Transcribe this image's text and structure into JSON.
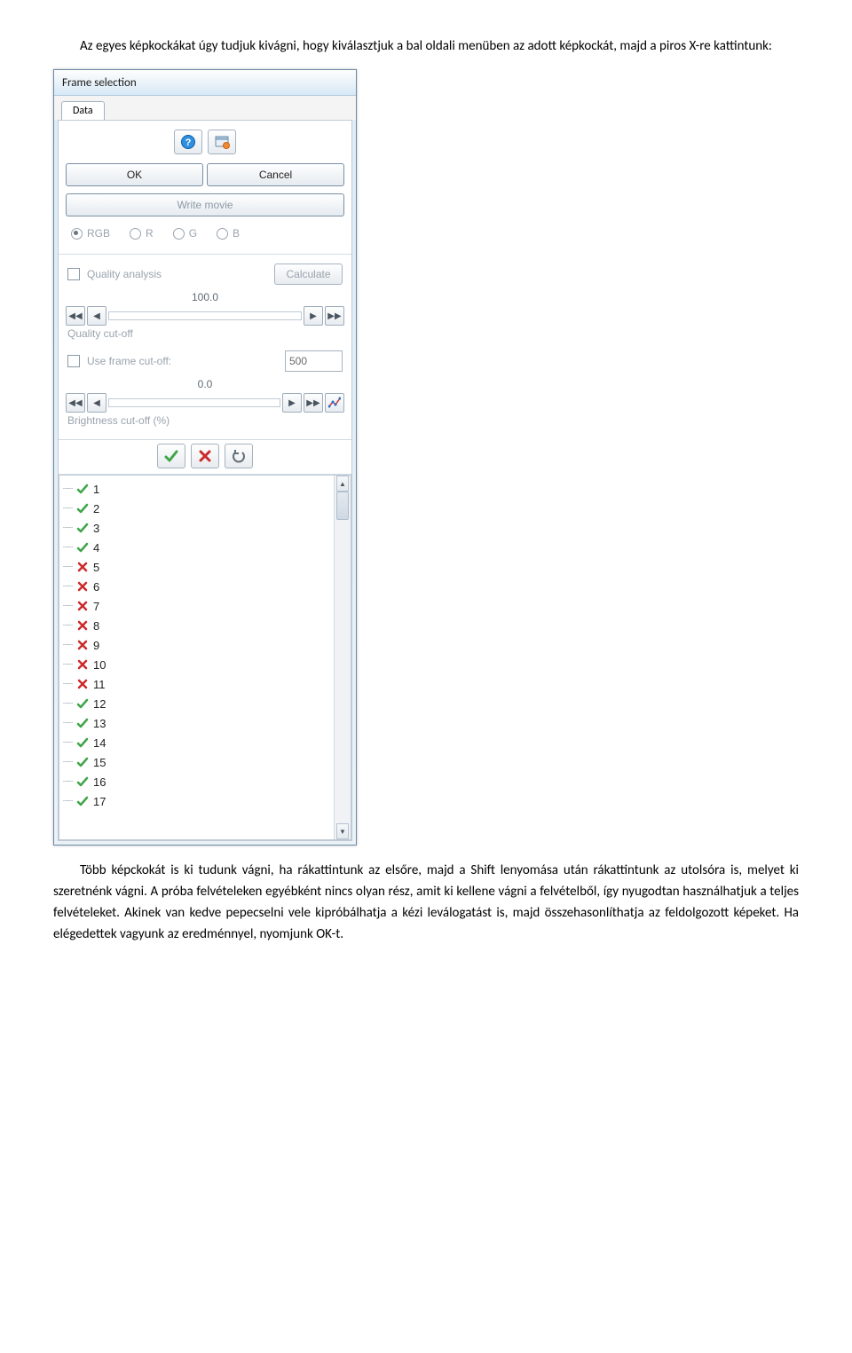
{
  "para1": "Az egyes képkockákat úgy tudjuk kivágni, hogy kiválasztjuk a bal oldali menüben az adott képkockát, majd a piros X-re kattintunk:",
  "para2": "Több képckokát is ki tudunk vágni, ha rákattintunk az elsőre, majd a Shift lenyomása után rákattintunk az utolsóra is, melyet ki szeretnénk vágni. A próba felvételeken egyébként nincs olyan rész, amit ki kellene vágni a felvételből, így nyugodtan használhatjuk a teljes felvételeket. Akinek van kedve pepecselni vele kipróbálhatja a kézi leválogatást is, majd összehasonlíthatja az feldolgozott képeket.  Ha elégedettek vagyunk az eredménnyel, nyomjunk OK-t.",
  "dialog": {
    "title": "Frame selection",
    "tab": "Data",
    "ok": "OK",
    "cancel": "Cancel",
    "write_movie": "Write movie",
    "radios": [
      "RGB",
      "R",
      "G",
      "B"
    ],
    "quality_analysis": "Quality analysis",
    "calculate": "Calculate",
    "quality_value": "100.0",
    "quality_cutoff": "Quality cut-off",
    "use_frame_cutoff": "Use frame cut-off:",
    "frame_cutoff_value": "500",
    "brightness_value": "0.0",
    "brightness_cutoff": "Brightness cut-off (%)",
    "frames": [
      {
        "n": "1",
        "ok": true
      },
      {
        "n": "2",
        "ok": true
      },
      {
        "n": "3",
        "ok": true
      },
      {
        "n": "4",
        "ok": true
      },
      {
        "n": "5",
        "ok": false
      },
      {
        "n": "6",
        "ok": false
      },
      {
        "n": "7",
        "ok": false
      },
      {
        "n": "8",
        "ok": false
      },
      {
        "n": "9",
        "ok": false
      },
      {
        "n": "10",
        "ok": false
      },
      {
        "n": "11",
        "ok": false
      },
      {
        "n": "12",
        "ok": true
      },
      {
        "n": "13",
        "ok": true
      },
      {
        "n": "14",
        "ok": true
      },
      {
        "n": "15",
        "ok": true
      },
      {
        "n": "16",
        "ok": true
      },
      {
        "n": "17",
        "ok": true
      }
    ]
  }
}
